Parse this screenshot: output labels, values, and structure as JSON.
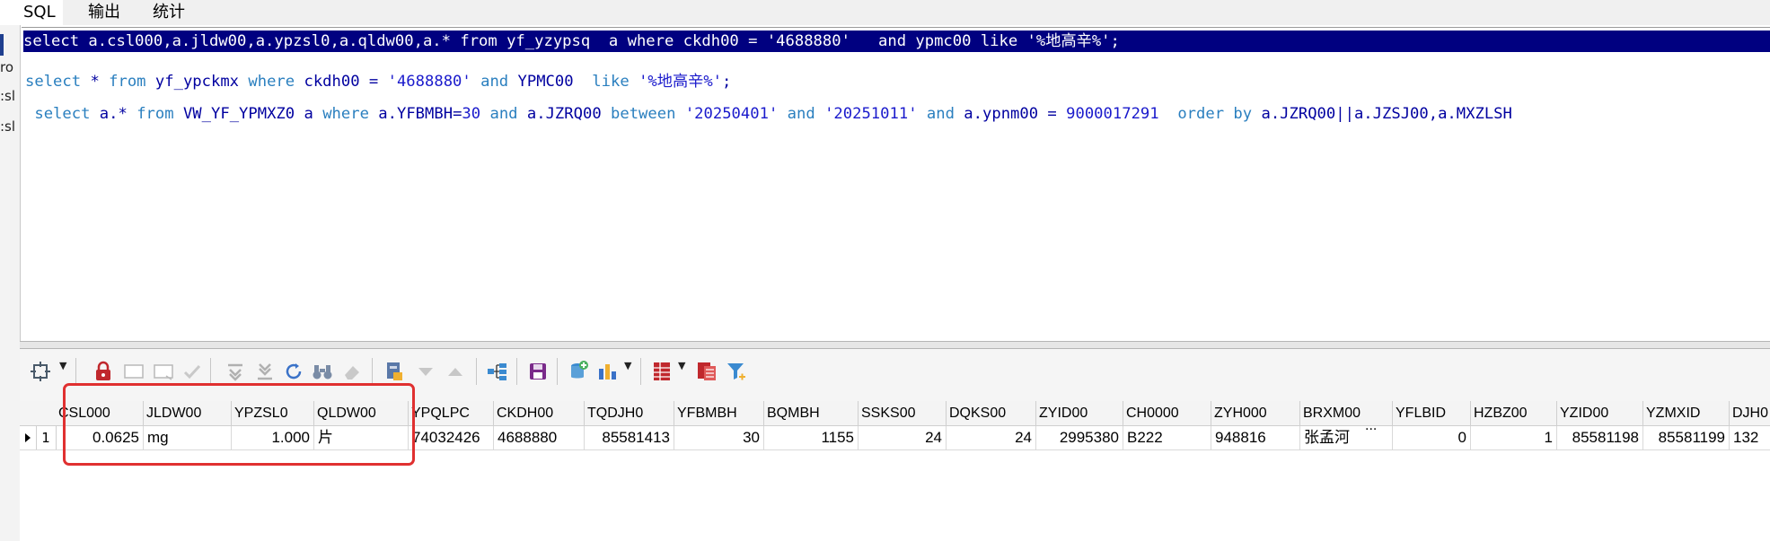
{
  "tabs": [
    {
      "label": "SQL"
    },
    {
      "label": "输出"
    },
    {
      "label": "统计"
    }
  ],
  "gutter_fragments": [
    "ro",
    ":sl",
    ":sl"
  ],
  "editor": {
    "line1": {
      "text": "select a.csl000,a.jldw00,a.ypzsl0,a.qldw00,a.* from yf_yzypsq  a where ckdh00 = '4688880'   and ypmc00 like '%地高辛%';"
    },
    "line2": {
      "kw_select": "select",
      "star": " * ",
      "kw_from": "from",
      "table": " yf_ypckmx ",
      "kw_where": "where",
      "cond1": " ckdh00 = ",
      "str1": "'4688880'",
      "sp1": " ",
      "kw_and": "and",
      "col": " YPMC00  ",
      "kw_like": "like",
      "sp2": " ",
      "str2": "'%地高辛%'",
      "end": ";"
    },
    "line3": {
      "lead": " ",
      "kw_select": "select",
      "cols": " a.* ",
      "kw_from": "from",
      "table": " VW_YF_YPMXZ0 a ",
      "kw_where": "where",
      "cond1": " a.YFBMBH=",
      "num1": "30",
      "sp1": " ",
      "kw_and1": "and",
      "cond2": " a.JZRQ00 ",
      "kw_between": "between",
      "sp2": " ",
      "str1": "'20250401'",
      "sp3": " ",
      "kw_and2": "and",
      "sp4": " ",
      "str2": "'20251011'",
      "sp5": " ",
      "kw_and3": "and",
      "cond3": " a.ypnm00 = ",
      "num2": "9000017291",
      "sp6": "  ",
      "kw_order": "order by",
      "order_cols": " a.JZRQ00||a.JZSJ00,a.MXZLSH"
    }
  },
  "grid": {
    "columns": [
      "CSL000",
      "JLDW00",
      "YPZSL0",
      "QLDW00",
      "YPQLPC",
      "CKDH00",
      "TQDJH0",
      "YFBMBH",
      "BQMBH",
      "SSKS00",
      "DQKS00",
      "ZYID00",
      "CH0000",
      "ZYH000",
      "BRXM00",
      "YFLBID",
      "HZBZ00",
      "YZID00",
      "YZMXID",
      "DJH0"
    ],
    "row_number": "1",
    "row": [
      "0.0625",
      "mg",
      "1.000",
      "片",
      "74032426",
      "4688880",
      "85581413",
      "30",
      "1155",
      "24",
      "24",
      "2995380",
      "B222",
      "948816",
      "张孟河",
      "0",
      "1",
      "85581198",
      "85581199",
      "132"
    ],
    "row_ellipsis": "···"
  },
  "colors": {
    "selection": "#000080",
    "keyword": "#2a7fbf",
    "highlight_box": "#e03030"
  },
  "icons": [
    "filter-select-icon",
    "lock-icon",
    "insert-row-icon",
    "delete-row-icon",
    "confirm-icon",
    "move-first-icon",
    "move-last-icon",
    "refresh-icon",
    "binoculars-icon",
    "eraser-icon",
    "export-icon",
    "sort-desc-icon",
    "sort-asc-icon",
    "tree-icon",
    "save-icon",
    "database-add-icon",
    "bar-chart-icon",
    "table-icon",
    "report-icon",
    "funnel-icon"
  ]
}
